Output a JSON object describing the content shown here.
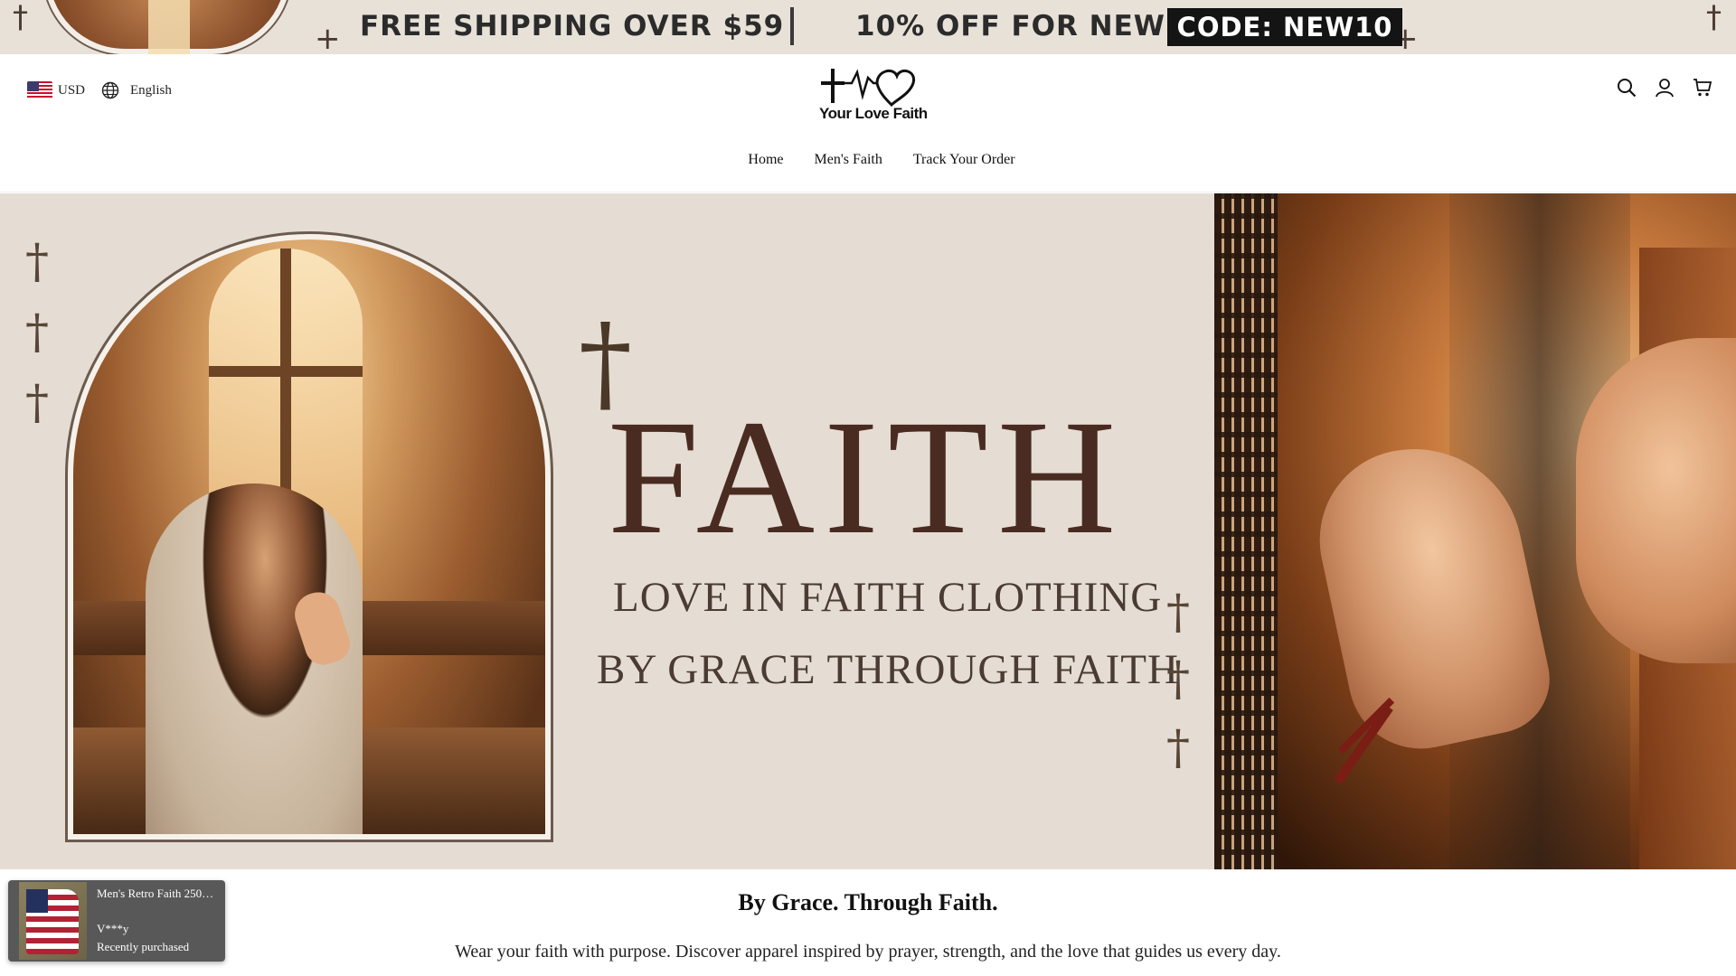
{
  "announcement": {
    "free_shipping": "FREE SHIPPING OVER $59",
    "discount": "10% OFF FOR NEW",
    "code": "CODE: NEW10"
  },
  "header": {
    "currency": "USD",
    "language": "English",
    "logo_text": "Your Love Faith",
    "icons": [
      "search-icon",
      "account-icon",
      "cart-icon"
    ]
  },
  "nav": {
    "items": [
      {
        "label": "Home"
      },
      {
        "label": "Men's Faith"
      },
      {
        "label": "Track Your Order"
      }
    ]
  },
  "hero": {
    "title": "FAITH",
    "line1": "LOVE IN FAITH CLOTHING",
    "line2": "BY GRACE THROUGH FAITH"
  },
  "intro": {
    "title": "By Grace. Through Faith.",
    "text": "Wear your faith with purpose. Discover apparel inspired by prayer, strength, and the love that guides us every day."
  },
  "popup": {
    "product_title": "Men's Retro Faith 250…",
    "user": "V***y",
    "status": "Recently purchased"
  },
  "colors": {
    "announcement_bg": "#e7e1d8",
    "hero_bg": "#e5ddd3",
    "faith_text": "#4a2b22",
    "code_bg": "#141414"
  }
}
